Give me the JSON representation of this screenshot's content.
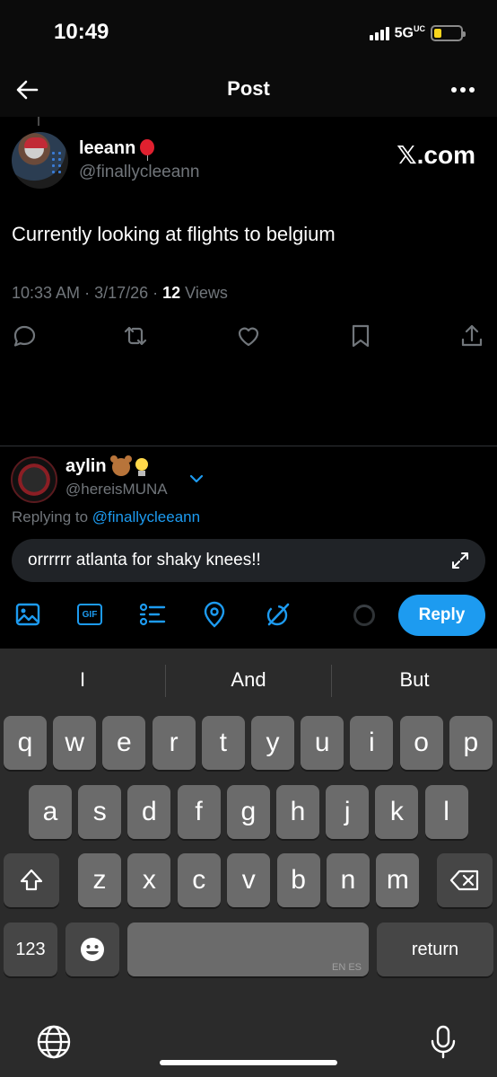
{
  "status": {
    "time": "10:49",
    "network": "5G",
    "network_sup": "UC",
    "battery_level": 0.3,
    "battery_color": "#f8d51c"
  },
  "header": {
    "title": "Post"
  },
  "post": {
    "author_name": "leeann",
    "author_handle": "@finallycleeann",
    "source_badge": "𝕏.com",
    "text": "Currently looking at flights to belgium",
    "time": "10:33 AM",
    "date": "3/17/26",
    "views_count": "12",
    "views_label": "Views"
  },
  "reply": {
    "author_name": "aylin",
    "author_handle": "@hereisMUNA",
    "replying_prefix": "Replying to",
    "replying_handle": "@finallycleeann",
    "draft_text": "orrrrrr atlanta for shaky knees!!",
    "button_label": "Reply"
  },
  "keyboard": {
    "suggestions": [
      "I",
      "And",
      "But"
    ],
    "row1": [
      "q",
      "w",
      "e",
      "r",
      "t",
      "y",
      "u",
      "i",
      "o",
      "p"
    ],
    "row2": [
      "a",
      "s",
      "d",
      "f",
      "g",
      "h",
      "j",
      "k",
      "l"
    ],
    "row3": [
      "z",
      "x",
      "c",
      "v",
      "b",
      "n",
      "m"
    ],
    "numbers_label": "123",
    "space_sub": "EN ES",
    "return_label": "return"
  },
  "colors": {
    "accent": "#1d9bf0",
    "muted": "#71767b"
  },
  "icons": [
    "back-arrow-icon",
    "more-icon",
    "reply-icon",
    "retweet-icon",
    "like-icon",
    "bookmark-icon",
    "share-icon",
    "chevron-down-icon",
    "expand-icon",
    "image-icon",
    "gif-icon",
    "poll-icon",
    "location-icon",
    "grok-icon",
    "shift-icon",
    "backspace-icon",
    "emoji-icon",
    "globe-icon",
    "mic-icon"
  ]
}
